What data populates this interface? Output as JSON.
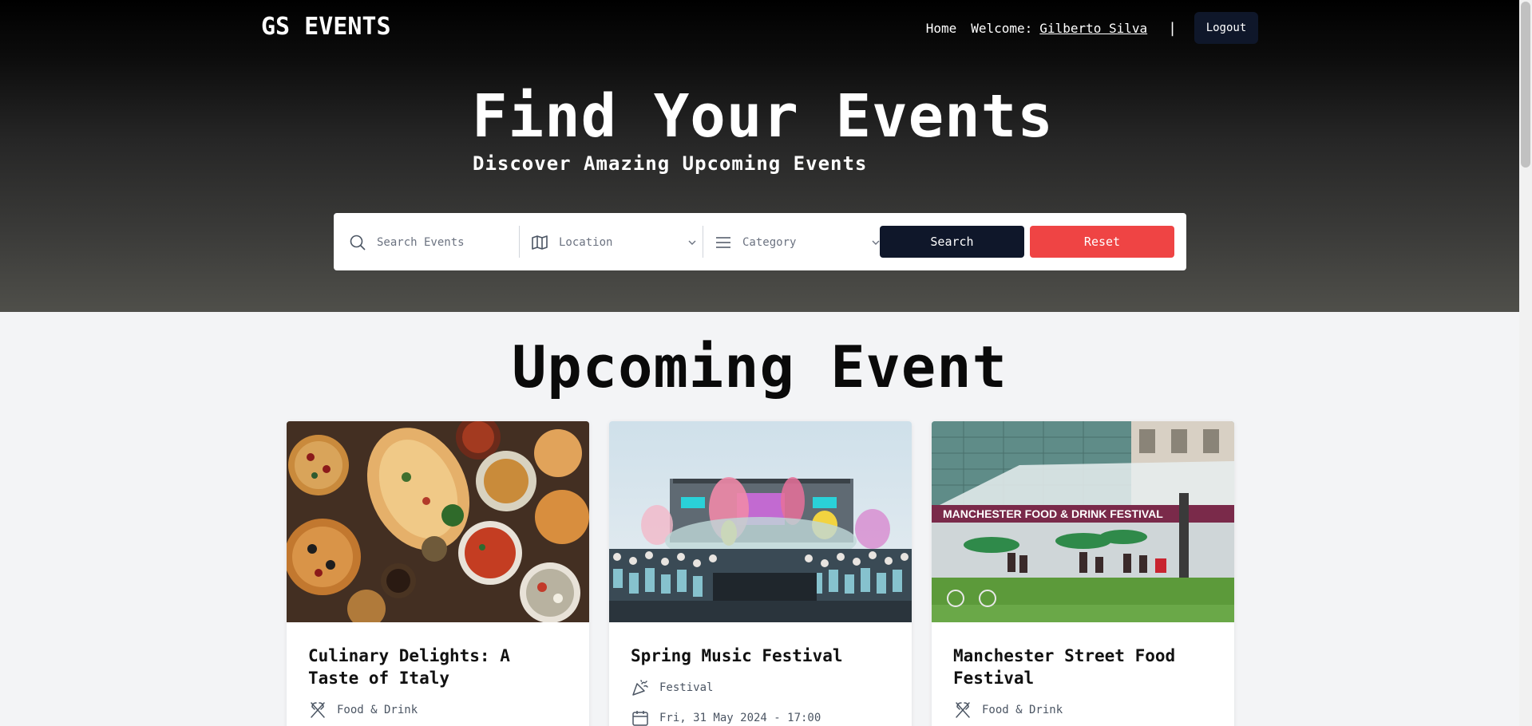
{
  "nav": {
    "brand": "GS EVENTS",
    "home": "Home",
    "welcome": "Welcome:",
    "user": "Gilberto Silva",
    "separator": "|",
    "logout": "Logout"
  },
  "hero": {
    "title": "Find Your Events",
    "subtitle": "Discover Amazing Upcoming Events"
  },
  "search": {
    "placeholder": "Search Events",
    "location": "Location",
    "category": "Category",
    "search_btn": "Search",
    "reset_btn": "Reset"
  },
  "section": {
    "title": "Upcoming Event"
  },
  "events": [
    {
      "title": "Culinary Delights: A Taste of Italy",
      "category": "Food & Drink",
      "category_icon": "utensils-icon"
    },
    {
      "title": "Spring Music Festival",
      "category": "Festival",
      "category_icon": "party-popper-icon",
      "date": "Fri, 31 May 2024 - 17:00"
    },
    {
      "title": "Manchester Street Food Festival",
      "category": "Food & Drink",
      "category_icon": "utensils-icon",
      "banner_text": "MANCHESTER FOOD & DRINK FESTIVAL"
    }
  ],
  "colors": {
    "primary": "#0f172a",
    "danger": "#ef4444",
    "background": "#f3f4f6"
  }
}
